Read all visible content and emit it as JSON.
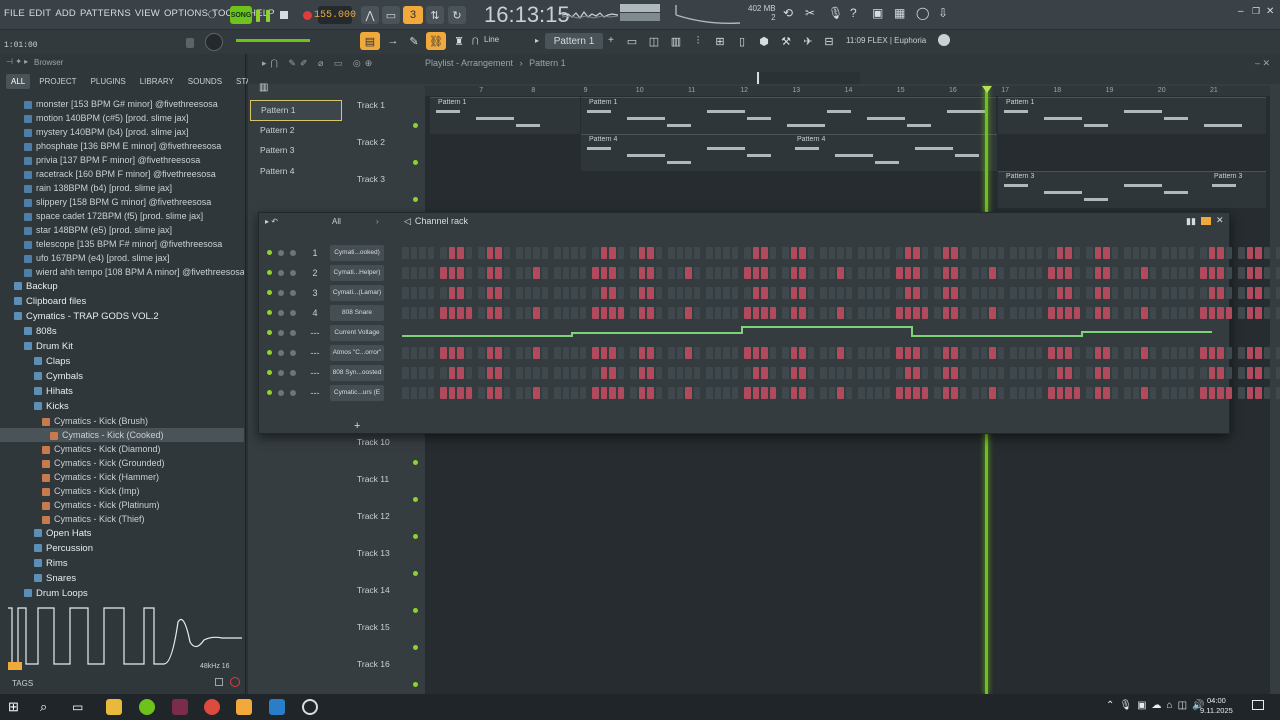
{
  "menu": [
    "FILE",
    "EDIT",
    "ADD",
    "PATTERNS",
    "VIEW",
    "OPTIONS",
    "TOOLS",
    "HELP"
  ],
  "transport": {
    "mode": "SONG",
    "tempo": "155.000",
    "clock": "16:13:15",
    "position": "1:01:00"
  },
  "meters": {
    "memory": "402 MB",
    "cores": "2"
  },
  "toolbar": {
    "snap": "Line",
    "pattern": "Pattern 1",
    "flex_info": "11:09  FLEX | Euphoria"
  },
  "browser": {
    "title": "Browser",
    "tabs": [
      "ALL",
      "PROJECT",
      "PLUGINS",
      "LIBRARY",
      "SOUNDS",
      "STARRED"
    ],
    "items": [
      {
        "label": "monster [153 BPM G# minor] @fivethreesosa",
        "type": "audio",
        "indent": 24
      },
      {
        "label": "motion 140BPM (c#5) [prod. slime jax]",
        "type": "audio",
        "indent": 24
      },
      {
        "label": "mystery 140BPM (b4) [prod. slime jax]",
        "type": "audio",
        "indent": 24
      },
      {
        "label": "phosphate [136 BPM E minor] @fivethreesosa",
        "type": "audio",
        "indent": 24
      },
      {
        "label": "privia [137 BPM F minor] @fivethreesosa",
        "type": "audio",
        "indent": 24
      },
      {
        "label": "racetrack [160 BPM F minor] @fivethreesosa",
        "type": "audio",
        "indent": 24
      },
      {
        "label": "rain 138BPM (b4) [prod. slime jax]",
        "type": "audio",
        "indent": 24
      },
      {
        "label": "slippery [158 BPM G minor] @fivethreesosa",
        "type": "audio",
        "indent": 24
      },
      {
        "label": "space cadet 172BPM (f5) [prod. slime jax]",
        "type": "audio",
        "indent": 24
      },
      {
        "label": "star 148BPM (e5) [prod. slime jax]",
        "type": "audio",
        "indent": 24
      },
      {
        "label": "telescope [135 BPM F# minor] @fivethreesosa",
        "type": "audio",
        "indent": 24
      },
      {
        "label": "ufo 167BPM (e4) [prod. slime jax]",
        "type": "audio",
        "indent": 24
      },
      {
        "label": "wierd ahh tempo [108 BPM A minor] @fivethreesosa",
        "type": "audio",
        "indent": 24
      },
      {
        "label": "Backup",
        "type": "folder",
        "indent": 14
      },
      {
        "label": "Clipboard files",
        "type": "folder",
        "indent": 14
      },
      {
        "label": "Cymatics - TRAP GODS VOL.2",
        "type": "folder",
        "indent": 14
      },
      {
        "label": "808s",
        "type": "folder",
        "indent": 24
      },
      {
        "label": "Drum Kit",
        "type": "folder",
        "indent": 24
      },
      {
        "label": "Claps",
        "type": "folder",
        "indent": 34
      },
      {
        "label": "Cymbals",
        "type": "folder",
        "indent": 34
      },
      {
        "label": "Hihats",
        "type": "folder",
        "indent": 34
      },
      {
        "label": "Kicks",
        "type": "folder",
        "indent": 34
      },
      {
        "label": "Cymatics - Kick (Brush)",
        "type": "kick",
        "indent": 42
      },
      {
        "label": "Cymatics - Kick (Cooked)",
        "type": "kick",
        "indent": 50,
        "selected": true
      },
      {
        "label": "Cymatics - Kick (Diamond)",
        "type": "kick",
        "indent": 42
      },
      {
        "label": "Cymatics - Kick (Grounded)",
        "type": "kick",
        "indent": 42
      },
      {
        "label": "Cymatics - Kick (Hammer)",
        "type": "kick",
        "indent": 42
      },
      {
        "label": "Cymatics - Kick (Imp)",
        "type": "kick",
        "indent": 42
      },
      {
        "label": "Cymatics - Kick (Platinum)",
        "type": "kick",
        "indent": 42
      },
      {
        "label": "Cymatics - Kick (Thief)",
        "type": "kick",
        "indent": 42
      },
      {
        "label": "Open Hats",
        "type": "folder",
        "indent": 34
      },
      {
        "label": "Percussion",
        "type": "folder",
        "indent": 34
      },
      {
        "label": "Rims",
        "type": "folder",
        "indent": 34
      },
      {
        "label": "Snares",
        "type": "folder",
        "indent": 34
      },
      {
        "label": "Drum Loops",
        "type": "folder",
        "indent": 24
      }
    ],
    "sample_rate": "48kHz 16",
    "tags": "TAGS"
  },
  "playlist": {
    "title": "Playlist - Arrangement",
    "current_pattern": "Pattern 1",
    "patterns": [
      "Pattern 1",
      "Pattern 2",
      "Pattern 3",
      "Pattern 4"
    ],
    "tracks": [
      "Track 1",
      "Track 2",
      "Track 3",
      "Track 10",
      "Track 11",
      "Track 12",
      "Track 13",
      "Track 14",
      "Track 15",
      "Track 16"
    ],
    "bars": [
      "7",
      "8",
      "9",
      "10",
      "11",
      "12",
      "13",
      "14",
      "15",
      "16",
      "17",
      "18",
      "19",
      "20",
      "21"
    ]
  },
  "channel_rack": {
    "title": "Channel rack",
    "filter": "All",
    "channels": [
      {
        "num": "1",
        "name": "Cymati...ooked)"
      },
      {
        "num": "2",
        "name": "Cymati...Helper)"
      },
      {
        "num": "3",
        "name": "Cymati...(Lamar)"
      },
      {
        "num": "4",
        "name": "808 Snare"
      },
      {
        "num": "---",
        "name": "Current Voltage"
      },
      {
        "num": "---",
        "name": "Atmos \"C...orror\""
      },
      {
        "num": "---",
        "name": "808 Syn...oosted"
      },
      {
        "num": "---",
        "name": "Cymatic...urs (E"
      }
    ]
  },
  "taskbar": {
    "time": "04:00",
    "date": "9.11.2025"
  }
}
